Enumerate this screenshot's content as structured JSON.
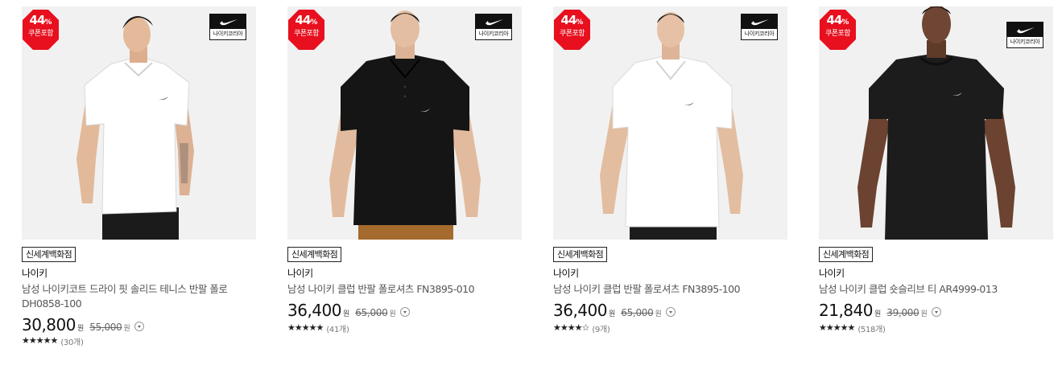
{
  "products": [
    {
      "discount": "44",
      "discount_unit": "%",
      "coupon_text": "쿠폰포함",
      "logo_text": "나이키코리아",
      "shirt_color": "#ffffff",
      "store": "신세계백화점",
      "brand": "나이키",
      "title": "남성 나이키코트 드라이 핏 솔리드 테니스 반팔 폴로 DH0858-100",
      "price": "30,800",
      "price_unit": "원",
      "original_price": "55,000",
      "stars": "★★★★★",
      "review_count": "(30개)"
    },
    {
      "discount": "44",
      "discount_unit": "%",
      "coupon_text": "쿠폰포함",
      "logo_text": "나이키코리아",
      "shirt_color": "#141414",
      "store": "신세계백화점",
      "brand": "나이키",
      "title": "남성 나이키 클럽 반팔 폴로셔츠 FN3895-010",
      "price": "36,400",
      "price_unit": "원",
      "original_price": "65,000",
      "stars": "★★★★★",
      "review_count": "(41개)"
    },
    {
      "discount": "44",
      "discount_unit": "%",
      "coupon_text": "쿠폰포함",
      "logo_text": "나이키코리아",
      "shirt_color": "#ffffff",
      "store": "신세계백화점",
      "brand": "나이키",
      "title": "남성 나이키 클럽 반팔 폴로셔츠 FN3895-100",
      "price": "36,400",
      "price_unit": "원",
      "original_price": "65,000",
      "stars": "★★★★☆",
      "review_count": "(9개)"
    },
    {
      "discount": "44",
      "discount_unit": "%",
      "coupon_text": "쿠폰포함",
      "logo_text": "나이키코리아",
      "shirt_color": "#1c1c1c",
      "store": "신세계백화점",
      "brand": "나이키",
      "title": "남성 나이키 클럽 숏슬리브 티 AR4999-013",
      "price": "21,840",
      "price_unit": "원",
      "original_price": "39,000",
      "stars": "★★★★★",
      "review_count": "(518개)"
    }
  ]
}
